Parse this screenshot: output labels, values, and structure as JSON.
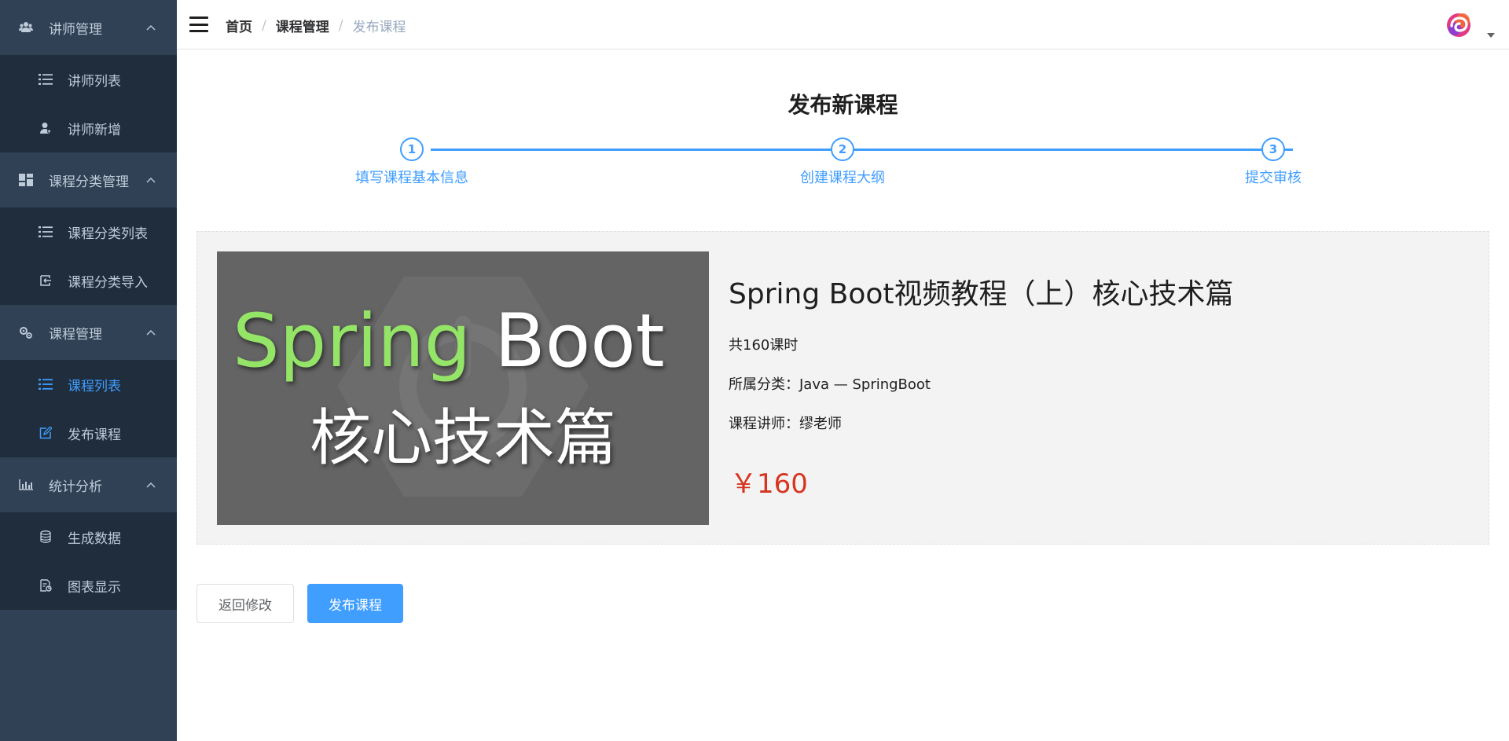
{
  "sidebar": {
    "groups": [
      {
        "label": "讲师管理",
        "icon": "users-icon",
        "expanded": true,
        "items": [
          {
            "label": "讲师列表",
            "icon": "list-icon",
            "active": false
          },
          {
            "label": "讲师新增",
            "icon": "user-add-icon",
            "active": false
          }
        ]
      },
      {
        "label": "课程分类管理",
        "icon": "dashboard-icon",
        "expanded": true,
        "items": [
          {
            "label": "课程分类列表",
            "icon": "list-icon",
            "active": false
          },
          {
            "label": "课程分类导入",
            "icon": "import-icon",
            "active": false
          }
        ]
      },
      {
        "label": "课程管理",
        "icon": "gears-icon",
        "expanded": true,
        "items": [
          {
            "label": "课程列表",
            "icon": "list-icon",
            "active": true
          },
          {
            "label": "发布课程",
            "icon": "edit-icon",
            "active": false
          }
        ]
      },
      {
        "label": "统计分析",
        "icon": "bar-chart-icon",
        "expanded": true,
        "items": [
          {
            "label": "生成数据",
            "icon": "database-icon",
            "active": false
          },
          {
            "label": "图表显示",
            "icon": "chart-doc-icon",
            "active": false
          }
        ]
      }
    ]
  },
  "header": {
    "breadcrumb": [
      "首页",
      "课程管理",
      "发布课程"
    ],
    "separator": "/",
    "avatar_icon": "avatar-logo-icon"
  },
  "main": {
    "title": "发布新课程",
    "steps": [
      {
        "number": "1",
        "label": "填写课程基本信息"
      },
      {
        "number": "2",
        "label": "创建课程大纲"
      },
      {
        "number": "3",
        "label": "提交审核"
      }
    ],
    "course": {
      "cover": {
        "line1_a": "Spring",
        "line1_b": "Boot",
        "line2": "核心技术篇"
      },
      "title": "Spring Boot视频教程（上）核心技术篇",
      "lessons": "共160课时",
      "category": "所属分类：Java — SpringBoot",
      "teacher": "课程讲师：缪老师",
      "price": "￥160"
    },
    "buttons": {
      "back": "返回修改",
      "publish": "发布课程"
    }
  },
  "colors": {
    "sidebar_bg": "#304156",
    "submenu_bg": "#1f2d3d",
    "menu_text": "#bfcbd9",
    "accent": "#409eff",
    "price": "#d6341f"
  }
}
